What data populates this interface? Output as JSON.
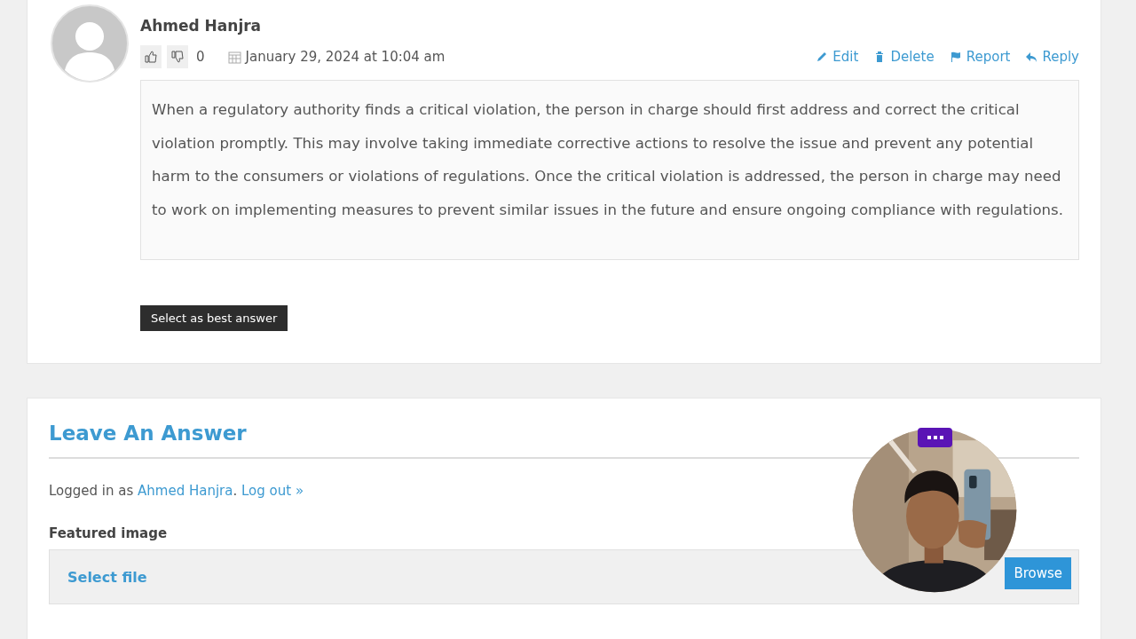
{
  "answer": {
    "author": "Ahmed Hanjra",
    "votes": {
      "count": "0"
    },
    "date": "January 29, 2024 at 10:04 am",
    "actions": [
      {
        "kind": "edit",
        "label": "Edit"
      },
      {
        "kind": "delete",
        "label": "Delete"
      },
      {
        "kind": "report",
        "label": "Report"
      },
      {
        "kind": "reply",
        "label": "Reply"
      }
    ],
    "body": "When a regulatory authority finds a critical violation, the person in charge should first address and correct the critical violation promptly. This may involve taking immediate corrective actions to resolve the issue and prevent any potential harm to the consumers or violations of regulations. Once the critical violation is addressed, the person in charge may need to work on implementing measures to prevent similar issues in the future and ensure ongoing compliance with regulations.",
    "best_answer_button": "Select as best answer"
  },
  "leave_answer": {
    "title": "Leave An Answer",
    "logged_in": {
      "prefix": "Logged in as",
      "user": "Ahmed Hanjra",
      "punctuation": ".",
      "log_out": "Log out »"
    },
    "featured_image": {
      "label": "Featured image",
      "select_file": "Select file",
      "browse": "Browse"
    }
  }
}
